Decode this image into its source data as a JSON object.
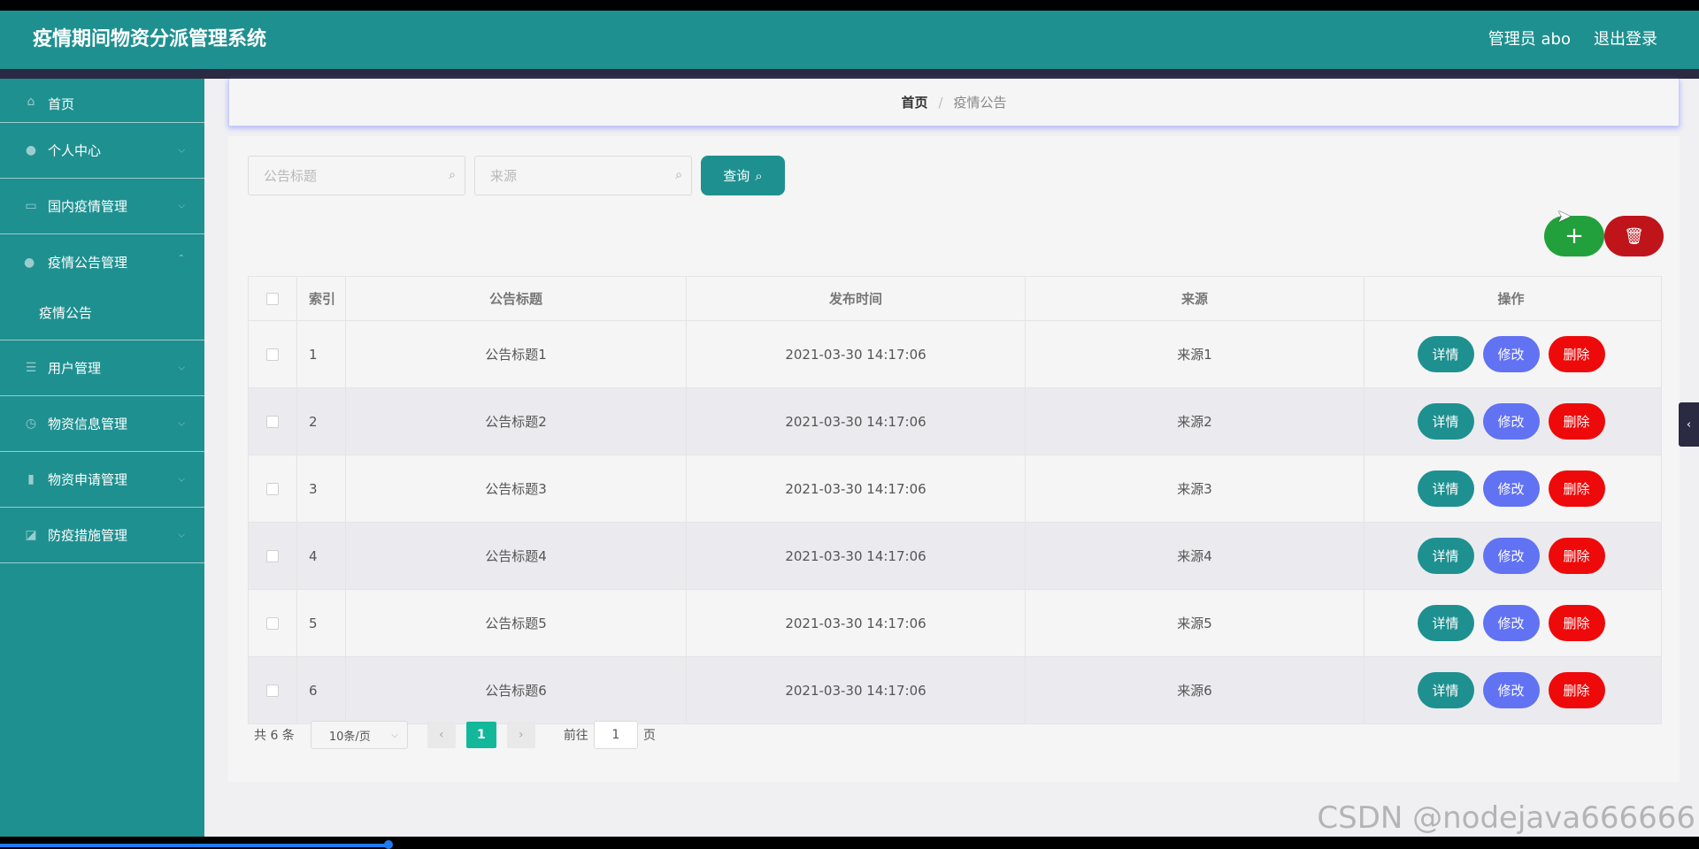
{
  "header": {
    "title": "疫情期间物资分派管理系统",
    "user": "管理员 abo",
    "logout": "退出登录"
  },
  "sidebar": {
    "items": [
      {
        "label": "首页",
        "icon": "home-icon"
      },
      {
        "label": "个人中心",
        "icon": "user-icon"
      },
      {
        "label": "国内疫情管理",
        "icon": "message-icon"
      },
      {
        "label": "疫情公告管理",
        "icon": "user-icon",
        "sub": "疫情公告"
      },
      {
        "label": "用户管理",
        "icon": "sliders-icon"
      },
      {
        "label": "物资信息管理",
        "icon": "clock-icon"
      },
      {
        "label": "物资申请管理",
        "icon": "bar-chart-icon"
      },
      {
        "label": "防疫措施管理",
        "icon": "chart-icon"
      }
    ]
  },
  "breadcrumb": {
    "home": "首页",
    "sep": "/",
    "current": "疫情公告"
  },
  "search": {
    "title_placeholder": "公告标题",
    "source_placeholder": "来源",
    "query_label": "查询"
  },
  "actions": {
    "add": "+",
    "delete": "🗑"
  },
  "table": {
    "headers": [
      "索引",
      "公告标题",
      "发布时间",
      "来源",
      "操作"
    ],
    "rows": [
      {
        "index": "1",
        "title": "公告标题1",
        "time": "2021-03-30 14:17:06",
        "source": "来源1"
      },
      {
        "index": "2",
        "title": "公告标题2",
        "time": "2021-03-30 14:17:06",
        "source": "来源2"
      },
      {
        "index": "3",
        "title": "公告标题3",
        "time": "2021-03-30 14:17:06",
        "source": "来源3"
      },
      {
        "index": "4",
        "title": "公告标题4",
        "time": "2021-03-30 14:17:06",
        "source": "来源4"
      },
      {
        "index": "5",
        "title": "公告标题5",
        "time": "2021-03-30 14:17:06",
        "source": "来源5"
      },
      {
        "index": "6",
        "title": "公告标题6",
        "time": "2021-03-30 14:17:06",
        "source": "来源6"
      }
    ],
    "op_detail": "详情",
    "op_edit": "修改",
    "op_delete": "删除"
  },
  "pagination": {
    "total": "共 6 条",
    "page_size": "10条/页",
    "current_page": "1",
    "goto_label": "前往",
    "goto_value": "1",
    "goto_unit": "页"
  },
  "watermark": "CSDN @nodejava666666",
  "colors": {
    "primary": "#1f9090",
    "edit": "#6172f3",
    "delete": "#ee0a0a",
    "add": "#22a03c"
  }
}
